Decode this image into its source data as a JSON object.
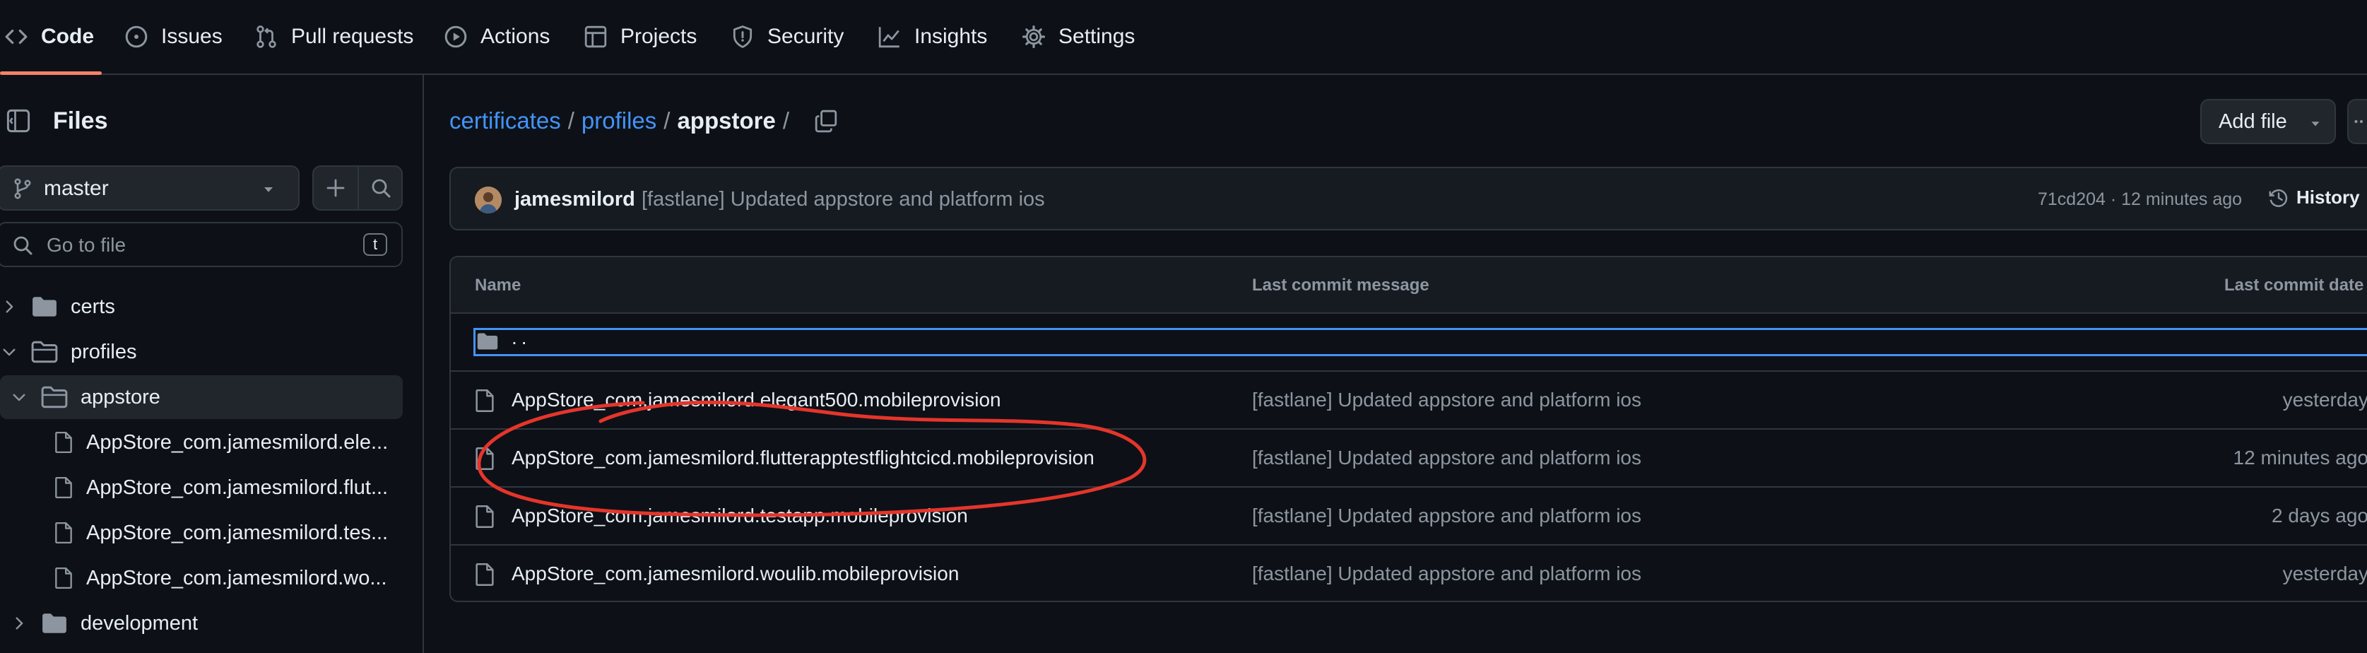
{
  "nav": {
    "tabs": [
      {
        "label": "Code",
        "icon": "code-icon",
        "active": true
      },
      {
        "label": "Issues",
        "icon": "issue-opened-icon"
      },
      {
        "label": "Pull requests",
        "icon": "git-pull-request-icon"
      },
      {
        "label": "Actions",
        "icon": "play-icon"
      },
      {
        "label": "Projects",
        "icon": "table-icon"
      },
      {
        "label": "Security",
        "icon": "shield-icon"
      },
      {
        "label": "Insights",
        "icon": "graph-icon"
      },
      {
        "label": "Settings",
        "icon": "gear-icon"
      }
    ]
  },
  "sidebar": {
    "title": "Files",
    "branch": "master",
    "search": {
      "placeholder": "Go to file",
      "shortcut": "t"
    },
    "tree": [
      {
        "label": "certs",
        "type": "folder",
        "expanded": false
      },
      {
        "label": "profiles",
        "type": "folder",
        "expanded": true
      },
      {
        "label": "appstore",
        "type": "folder",
        "expanded": true,
        "selected": true
      },
      {
        "label": "AppStore_com.jamesmilord.ele...",
        "type": "file"
      },
      {
        "label": "AppStore_com.jamesmilord.flut...",
        "type": "file"
      },
      {
        "label": "AppStore_com.jamesmilord.tes...",
        "type": "file"
      },
      {
        "label": "AppStore_com.jamesmilord.wo...",
        "type": "file"
      },
      {
        "label": "development",
        "type": "folder",
        "expanded": false
      }
    ]
  },
  "breadcrumb": {
    "parts": [
      "certificates",
      "profiles",
      "appstore"
    ],
    "separator": "/"
  },
  "actions": {
    "add_file": "Add file"
  },
  "commit": {
    "author": "jamesmilord",
    "message": "[fastlane] Updated appstore and platform ios",
    "meta": "71cd204 · 12 minutes ago",
    "history": "History"
  },
  "table": {
    "headers": {
      "name": "Name",
      "message": "Last commit message",
      "date": "Last commit date"
    },
    "parent": "..",
    "rows": [
      {
        "name": "AppStore_com.jamesmilord.elegant500.mobileprovision",
        "message": "[fastlane] Updated appstore and platform ios",
        "date": "yesterday"
      },
      {
        "name": "AppStore_com.jamesmilord.flutterapptestflightcicd.mobileprovision",
        "message": "[fastlane] Updated appstore and platform ios",
        "date": "12 minutes ago"
      },
      {
        "name": "AppStore_com.jamesmilord.testapp.mobileprovision",
        "message": "[fastlane] Updated appstore and platform ios",
        "date": "2 days ago"
      },
      {
        "name": "AppStore_com.jamesmilord.woulib.mobileprovision",
        "message": "[fastlane] Updated appstore and platform ios",
        "date": "yesterday"
      }
    ]
  },
  "colors": {
    "background": "#0d1117",
    "link": "#4493f8",
    "accent_underline": "#f78166",
    "annotation": "#e5352b"
  }
}
